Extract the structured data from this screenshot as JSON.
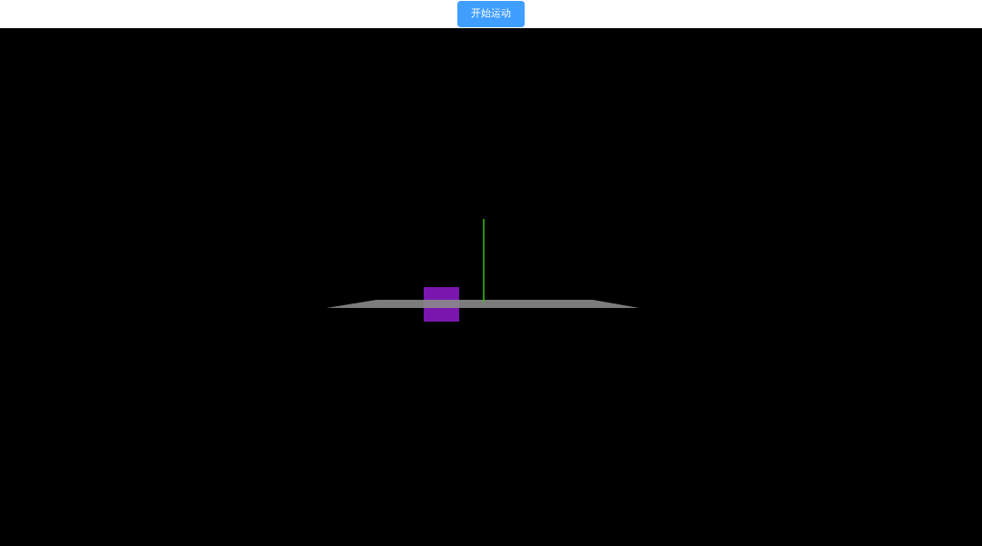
{
  "toolbar": {
    "button": "开始运动"
  }
}
